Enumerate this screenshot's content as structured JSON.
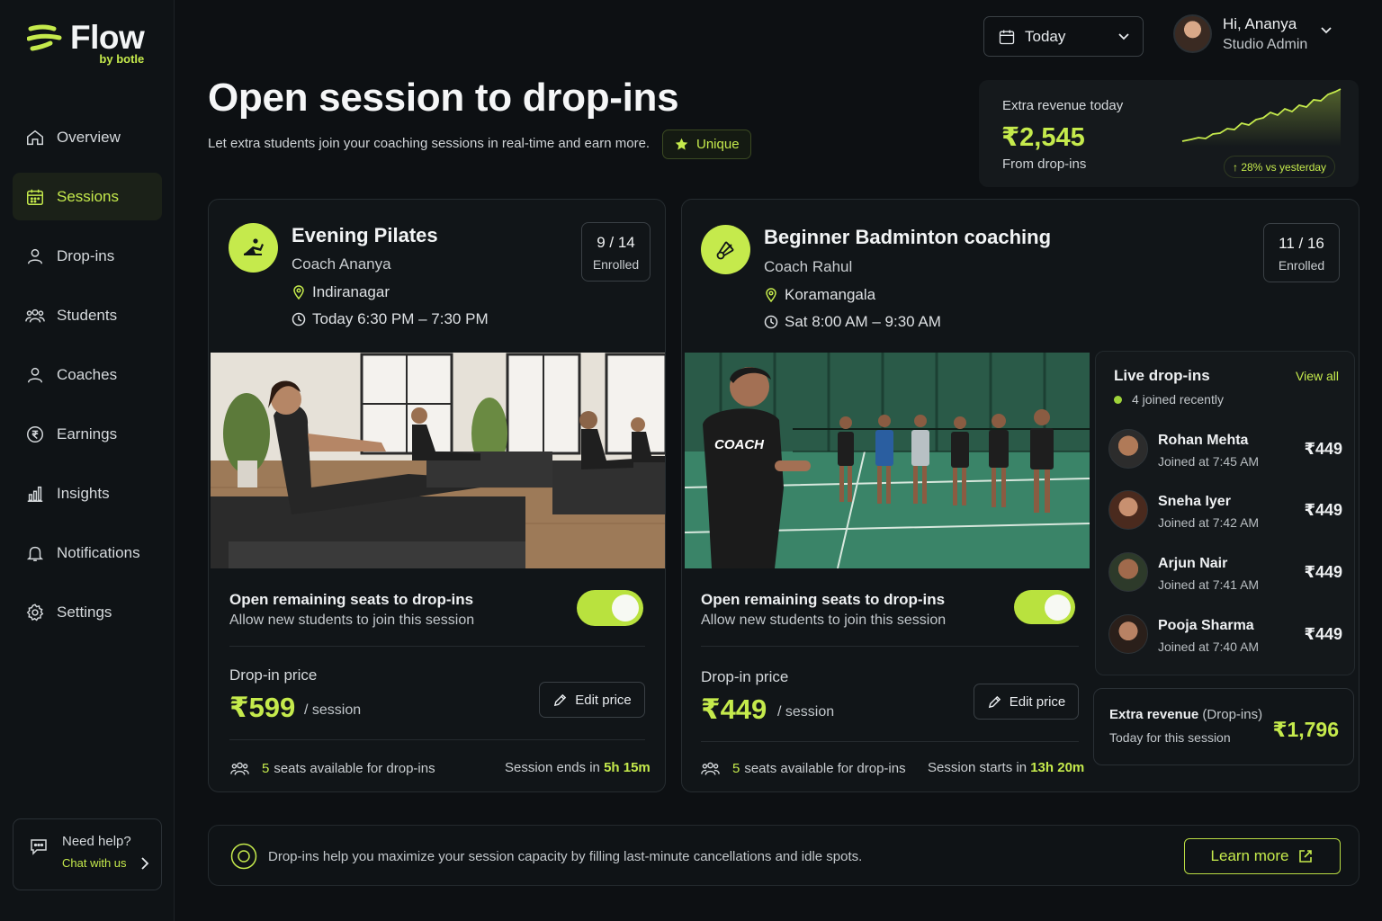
{
  "brand": {
    "name": "Flow",
    "sub": "by botle"
  },
  "colors": {
    "accent": "#c5ea4c",
    "background": "#0d1013",
    "card": "#111518"
  },
  "nav": [
    {
      "label": "Overview",
      "icon": "home-icon"
    },
    {
      "label": "Sessions",
      "icon": "calendar-icon",
      "active": true
    },
    {
      "label": "Drop-ins",
      "icon": "user-icon"
    },
    {
      "label": "Students",
      "icon": "users-icon"
    },
    {
      "label": "Coaches",
      "icon": "user-icon"
    },
    {
      "label": "Earnings",
      "icon": "rupee-circle-icon"
    },
    {
      "label": "Insights",
      "icon": "bar-chart-icon"
    },
    {
      "label": "Notifications",
      "icon": "bell-icon"
    },
    {
      "label": "Settings",
      "icon": "gear-icon"
    }
  ],
  "help": {
    "title": "Need help?",
    "link": "Chat with us"
  },
  "header": {
    "date_select": "Today",
    "user_greeting": "Hi, Ananya",
    "user_role": "Studio Admin"
  },
  "page": {
    "title": "Open session to drop-ins",
    "subtitle": "Let extra students join your coaching sessions in real-time and earn more.",
    "badge": "Unique"
  },
  "revenue": {
    "label": "Extra revenue today",
    "value": "₹2,545",
    "from": "From drop-ins",
    "delta": "↑ 28% vs yesterday"
  },
  "sessions": [
    {
      "title": "Evening Pilates",
      "coach": "Coach Ananya",
      "location": "Indiranagar",
      "time": "Today 6:30 PM – 7:30 PM",
      "enrolled": "9 / 14",
      "enrolled_label": "Enrolled",
      "toggle_title": "Open remaining seats to drop-ins",
      "toggle_sub": "Allow new students to join this session",
      "toggle_on": true,
      "price_label": "Drop-in price",
      "price": "₹599",
      "price_unit": "/ session",
      "edit_label": "Edit price",
      "seats_num": "5",
      "seats_text": "seats available for drop-ins",
      "time_label": "Session ends in",
      "time_value": "5h 15m"
    },
    {
      "title": "Beginner Badminton coaching",
      "coach": "Coach Rahul",
      "location": "Koramangala",
      "time": "Sat 8:00 AM – 9:30 AM",
      "enrolled": "11 / 16",
      "enrolled_label": "Enrolled",
      "toggle_title": "Open remaining seats to drop-ins",
      "toggle_sub": "Allow new students to join this session",
      "toggle_on": true,
      "price_label": "Drop-in price",
      "price": "₹449",
      "price_unit": "/ session",
      "edit_label": "Edit price",
      "seats_num": "5",
      "seats_text": "seats available for drop-ins",
      "time_label": "Session starts in",
      "time_value": "13h 20m",
      "shirt_text": "COACH"
    }
  ],
  "live": {
    "title": "Live drop-ins",
    "view_all": "View all",
    "status": "4 joined recently",
    "items": [
      {
        "name": "Rohan Mehta",
        "time": "Joined at 7:45 AM",
        "amount": "₹449"
      },
      {
        "name": "Sneha Iyer",
        "time": "Joined at 7:42 AM",
        "amount": "₹449"
      },
      {
        "name": "Arjun Nair",
        "time": "Joined at 7:41 AM",
        "amount": "₹449"
      },
      {
        "name": "Pooja Sharma",
        "time": "Joined at 7:40 AM",
        "amount": "₹449"
      }
    ]
  },
  "extra": {
    "title_bold": "Extra revenue",
    "title_rest": "(Drop-ins)",
    "sub": "Today for this session",
    "value": "₹1,796"
  },
  "info": {
    "text": "Drop-ins help you maximize your session capacity by filling last-minute cancellations and idle spots.",
    "button": "Learn more"
  }
}
